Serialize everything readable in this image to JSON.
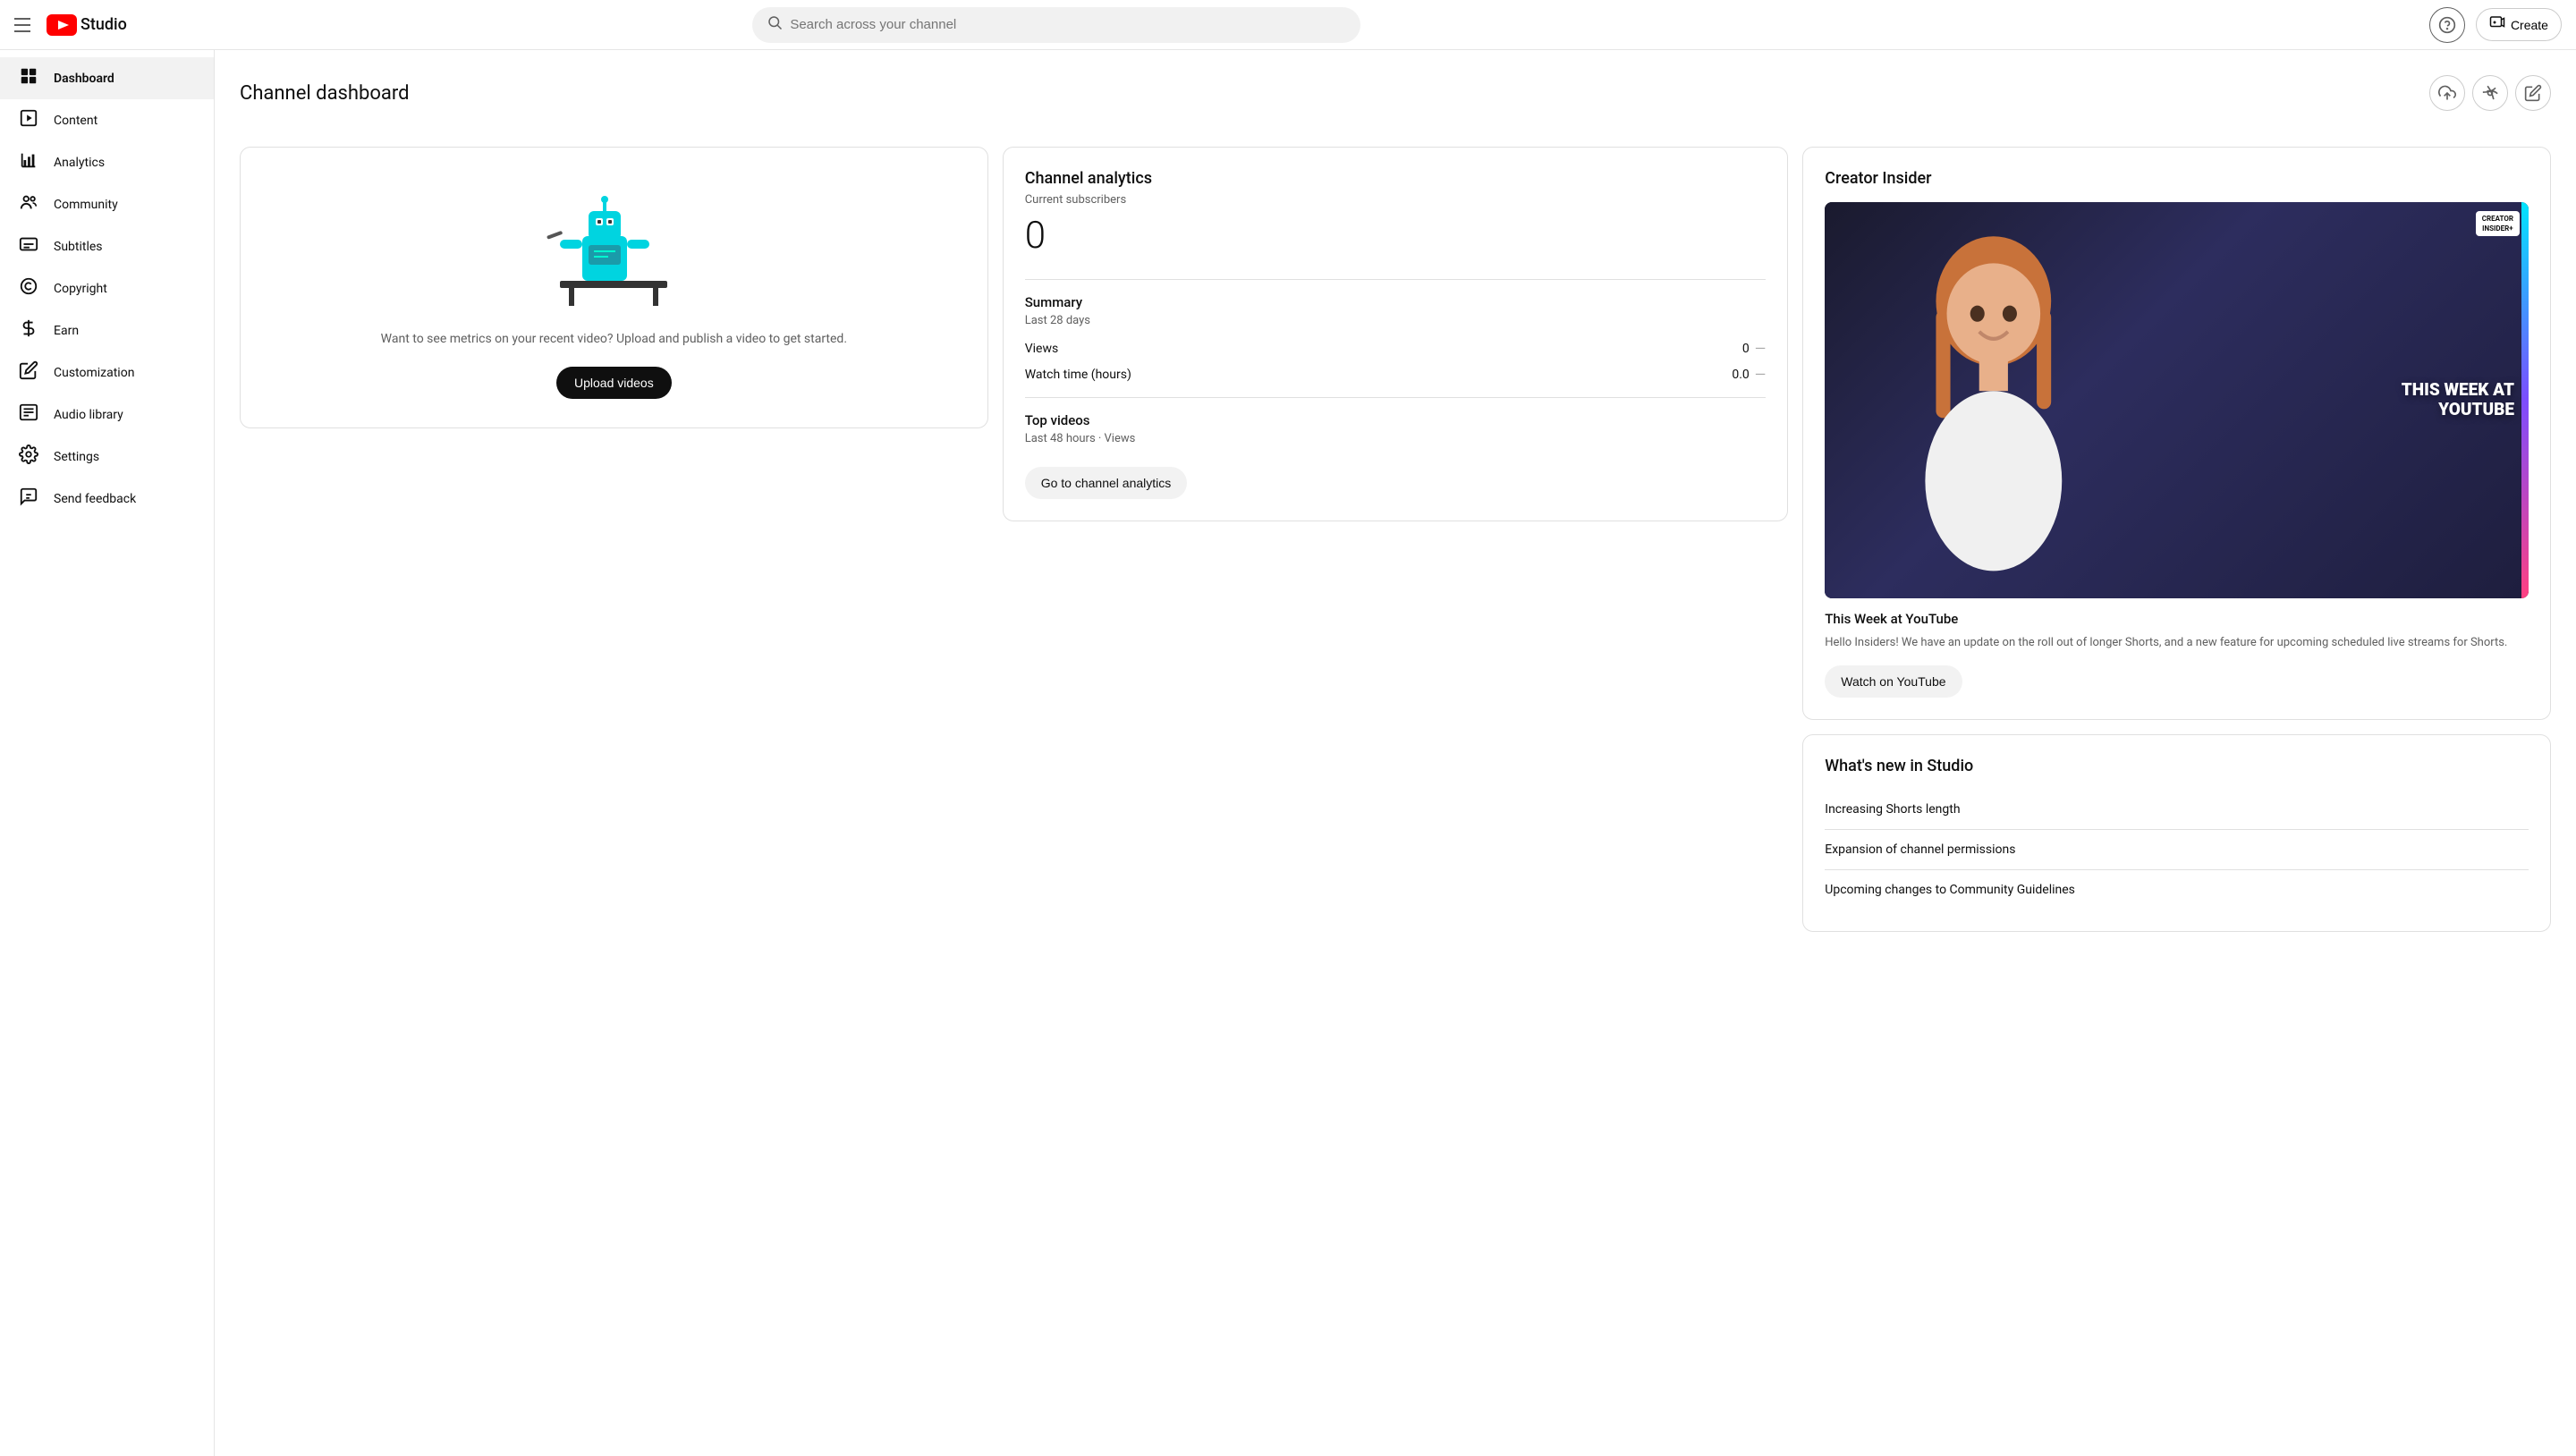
{
  "topnav": {
    "hamburger_label": "Menu",
    "logo_text": "Studio",
    "search_placeholder": "Search across your channel",
    "help_label": "Help",
    "create_label": "Create"
  },
  "sidebar": {
    "items": [
      {
        "id": "dashboard",
        "label": "Dashboard",
        "icon": "⊞",
        "active": true
      },
      {
        "id": "content",
        "label": "Content",
        "icon": "▣"
      },
      {
        "id": "analytics",
        "label": "Analytics",
        "icon": "📊"
      },
      {
        "id": "community",
        "label": "Community",
        "icon": "👥"
      },
      {
        "id": "subtitles",
        "label": "Subtitles",
        "icon": "▤"
      },
      {
        "id": "copyright",
        "label": "Copyright",
        "icon": "©"
      },
      {
        "id": "earn",
        "label": "Earn",
        "icon": "💲"
      },
      {
        "id": "customization",
        "label": "Customization",
        "icon": "✏"
      },
      {
        "id": "audio-library",
        "label": "Audio library",
        "icon": "⊡"
      },
      {
        "id": "settings",
        "label": "Settings",
        "icon": "⚙"
      },
      {
        "id": "send-feedback",
        "label": "Send feedback",
        "icon": "💬"
      }
    ]
  },
  "dashboard": {
    "title": "Channel dashboard",
    "upload_card": {
      "text": "Want to see metrics on your recent video? Upload and publish a video to get started.",
      "button_label": "Upload videos"
    },
    "analytics_card": {
      "title": "Channel analytics",
      "subscribers_label": "Current subscribers",
      "subscribers_count": "0",
      "summary_title": "Summary",
      "summary_period": "Last 28 days",
      "views_label": "Views",
      "views_value": "0",
      "watch_time_label": "Watch time (hours)",
      "watch_time_value": "0.0",
      "top_videos_title": "Top videos",
      "top_videos_period": "Last 48 hours · Views",
      "analytics_btn": "Go to channel analytics"
    },
    "creator_insider": {
      "title": "Creator Insider",
      "badge_line1": "CREATOR",
      "badge_line2": "INSIDER+",
      "thumb_text_line1": "THIS WEEK AT",
      "thumb_text_line2": "YOUTUBE",
      "episode_title": "This Week at YouTube",
      "description": "Hello Insiders! We have an update on the roll out of longer Shorts, and a new feature for upcoming scheduled live streams for Shorts.",
      "watch_btn": "Watch on YouTube"
    },
    "whats_new": {
      "title": "What's new in Studio",
      "items": [
        "Increasing Shorts length",
        "Expansion of channel permissions",
        "Upcoming changes to Community Guidelines"
      ]
    },
    "action_icons": {
      "upload": "⬆",
      "live": "◉",
      "edit": "✎"
    }
  }
}
